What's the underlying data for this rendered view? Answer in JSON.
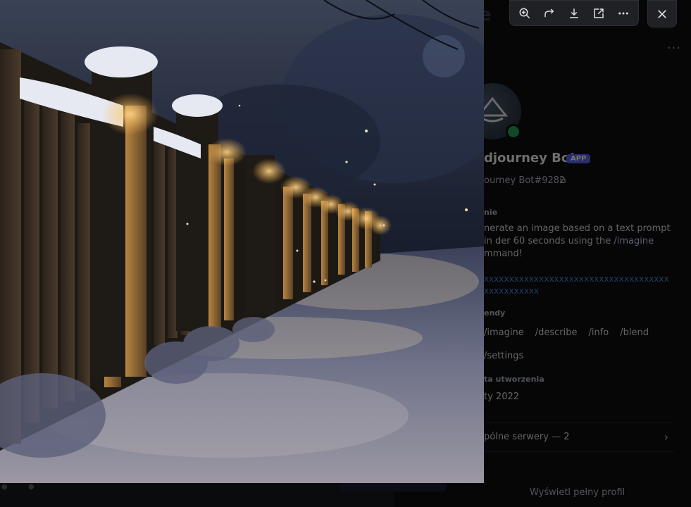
{
  "toolbar": {
    "buttons": [
      {
        "icon": "zoom-in-icon"
      },
      {
        "icon": "share-forward-icon"
      },
      {
        "icon": "download-icon"
      },
      {
        "icon": "open-in-browser-icon"
      },
      {
        "icon": "more-options-icon"
      }
    ],
    "close_icon": "close-icon"
  },
  "image": {
    "subject": "snow-covered wooden fence lit by post lights at night"
  },
  "profile": {
    "partial_header": "e",
    "more": "···",
    "name": "djourney Bot",
    "badge": "APP",
    "handle": "ourney Bot#9282",
    "about_label": "nie",
    "description_before": "nerate an image based on a text prompt in der 60 seconds using the ",
    "description_command": "/imagine",
    "description_after": " mmand!",
    "link_text": "xxxxxxxxxxxxxxxxxxxxxxxxxxxxxxxxxxxxx xxxxxxxxxxx",
    "commands_label": "endy",
    "commands": [
      "/imagine",
      "/describe",
      "/info",
      "/blend"
    ],
    "settings_command": "/settings",
    "created_label": "ta utworzenia",
    "created_date": "ty 2022",
    "servers_label": "pólne serwery — 2",
    "servers_chevron": "›",
    "full_profile": "Wyświetl pełny profil"
  },
  "colors": {
    "accent": "#5865f2",
    "online": "#23a55a",
    "toolbar_bg": "#1f2125",
    "icon": "#dbdee1"
  }
}
